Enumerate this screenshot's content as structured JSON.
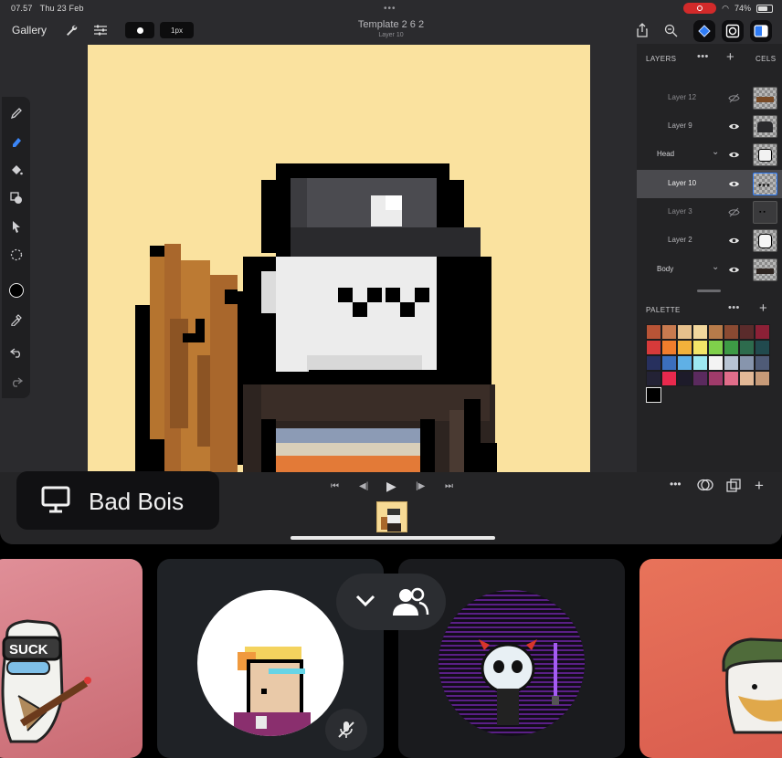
{
  "status_bar": {
    "time": "07.57",
    "date": "Thu 23 Feb",
    "battery": "74%"
  },
  "toolbar": {
    "gallery_label": "Gallery",
    "brush_size": "1px",
    "document_title": "Template 2 6 2",
    "current_layer": "Layer 10"
  },
  "layers_panel": {
    "title": "LAYERS",
    "cels_label": "CELS",
    "layers": [
      {
        "name": "Layer 12",
        "visible": false,
        "selected": false
      },
      {
        "name": "Layer 9",
        "visible": true,
        "selected": false
      },
      {
        "name": "Head",
        "visible": true,
        "selected": false,
        "group": true
      },
      {
        "name": "Layer 10",
        "visible": true,
        "selected": true
      },
      {
        "name": "Layer 3",
        "visible": false,
        "selected": false
      },
      {
        "name": "Layer 2",
        "visible": true,
        "selected": false
      },
      {
        "name": "Body",
        "visible": true,
        "selected": false,
        "group": true
      }
    ]
  },
  "palette": {
    "title": "PALETTE",
    "colors": [
      "#b85436",
      "#c87a4f",
      "#e6c08c",
      "#f2d79d",
      "#b77b4a",
      "#8a4a32",
      "#5a2b2b",
      "#8c2036",
      "#d63a3a",
      "#f07d2c",
      "#f2b13b",
      "#f3e468",
      "#7fd04b",
      "#3d9a45",
      "#2d6b4d",
      "#214a4e",
      "#27305e",
      "#3b6fbd",
      "#5fb0e6",
      "#9de8f1",
      "#f3f3f3",
      "#b8c4d3",
      "#8795ad",
      "#4f5b77",
      "#232235",
      "#e8294d",
      "#1d1b2a",
      "#5a2a5e",
      "#a03b6b",
      "#e16d8a",
      "#e2b896",
      "#c69a78"
    ],
    "current_color": "#000000"
  },
  "stream": {
    "name": "Bad Bois"
  },
  "colors": {
    "canvas_bg": "#fae29f",
    "accent": "#2f7cf6"
  }
}
